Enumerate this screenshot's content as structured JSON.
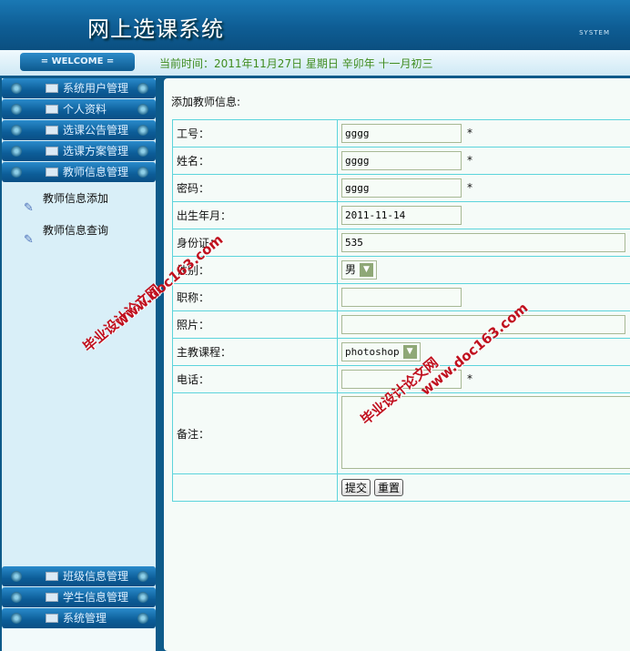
{
  "header": {
    "title": "网上选课系统",
    "badge": "SYSTEM"
  },
  "welcome": {
    "label": "= WELCOME =",
    "datetime": "当前时间：2011年11月27日 星期日 辛卯年 十一月初三"
  },
  "sidebar": {
    "top_items": [
      {
        "label": "系统用户管理"
      },
      {
        "label": "个人资料"
      },
      {
        "label": "选课公告管理"
      },
      {
        "label": "选课方案管理"
      },
      {
        "label": "教师信息管理"
      }
    ],
    "sub_items": [
      {
        "label": "教师信息添加"
      },
      {
        "label": "教师信息查询"
      }
    ],
    "bottom_items": [
      {
        "label": "班级信息管理"
      },
      {
        "label": "学生信息管理"
      },
      {
        "label": "系统管理"
      }
    ]
  },
  "form": {
    "title": "添加教师信息:",
    "fields": {
      "id": {
        "label": "工号：",
        "value": "gggg"
      },
      "name": {
        "label": "姓名：",
        "value": "gggg"
      },
      "password": {
        "label": "密码：",
        "value": "gggg"
      },
      "birth": {
        "label": "出生年月：",
        "value": "2011-11-14"
      },
      "idcard": {
        "label": "身份证：",
        "value": "535"
      },
      "gender": {
        "label": "性别：",
        "value": "男"
      },
      "title": {
        "label": "职称：",
        "value": ""
      },
      "photo": {
        "label": "照片：",
        "value": ""
      },
      "course": {
        "label": "主教课程：",
        "value": "photoshop"
      },
      "phone": {
        "label": "电话：",
        "value": ""
      },
      "remark": {
        "label": "备注：",
        "value": ""
      }
    },
    "required_mark": "*",
    "submit": "提交",
    "reset": "重置"
  },
  "watermark": {
    "text1": "毕业设计论文网",
    "text2": "www.doc163.com"
  }
}
